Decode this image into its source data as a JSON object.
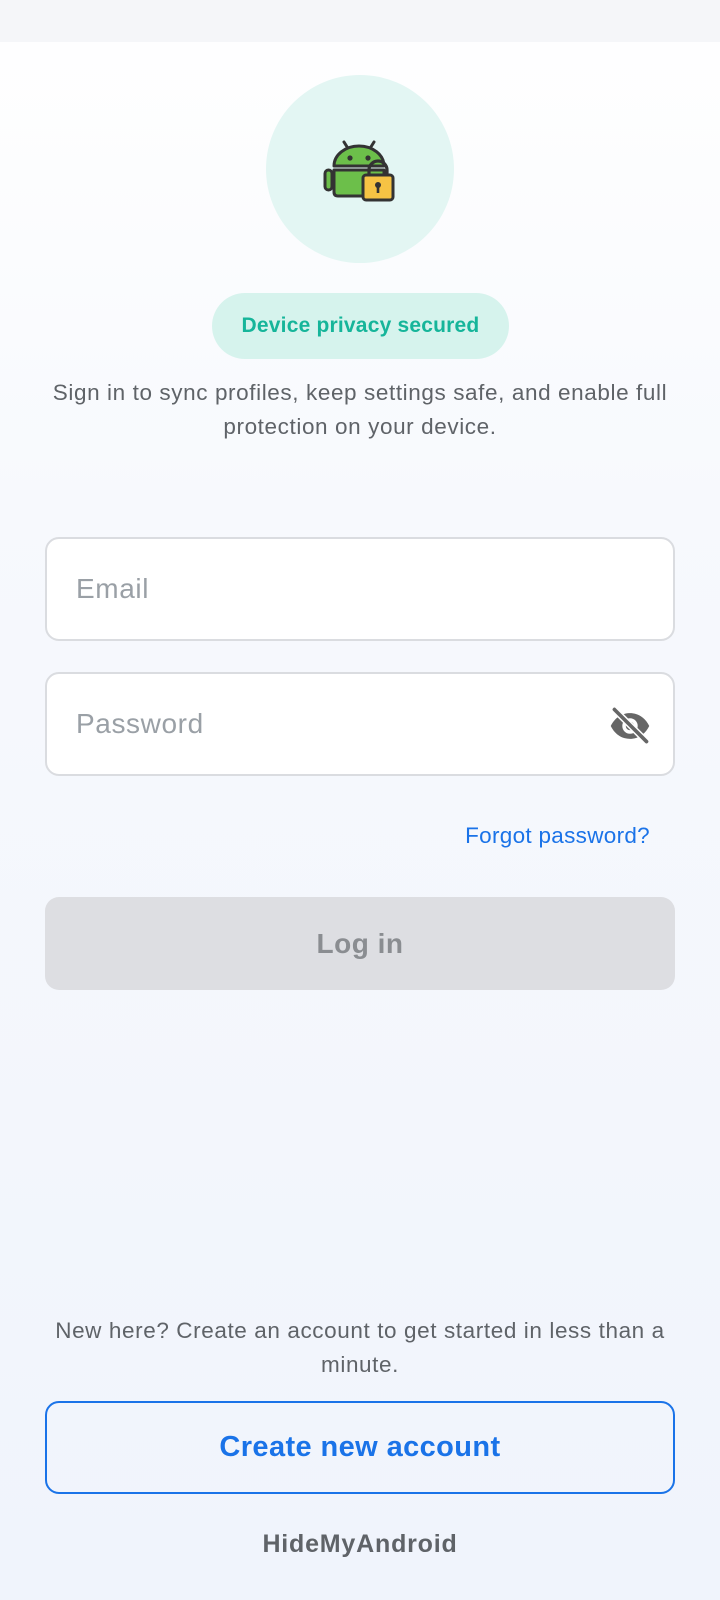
{
  "badge": {
    "label": "Device privacy secured"
  },
  "subtitle": {
    "text": "Sign in to sync profiles, keep settings safe, and enable full protection on your device."
  },
  "form": {
    "email_placeholder": "Email",
    "password_placeholder": "Password",
    "password_toggle_icon": "eye-off-icon",
    "forgot_label": "Forgot password?",
    "login_label": "Log in",
    "login_enabled": false
  },
  "signup": {
    "prompt": "New here? Create an account to get started in less than a minute.",
    "button_label": "Create new account"
  },
  "footer": {
    "brand": "HideMyAndroid"
  },
  "icons": {
    "hero": "android-lock-icon"
  },
  "colors": {
    "accent": "#1a73e8",
    "badge_text": "#16b59a",
    "badge_bg": "#d6f3ed",
    "hero_bg": "#e3f6f3",
    "android_green": "#6cbf4a",
    "lock_yellow": "#f6c344"
  }
}
